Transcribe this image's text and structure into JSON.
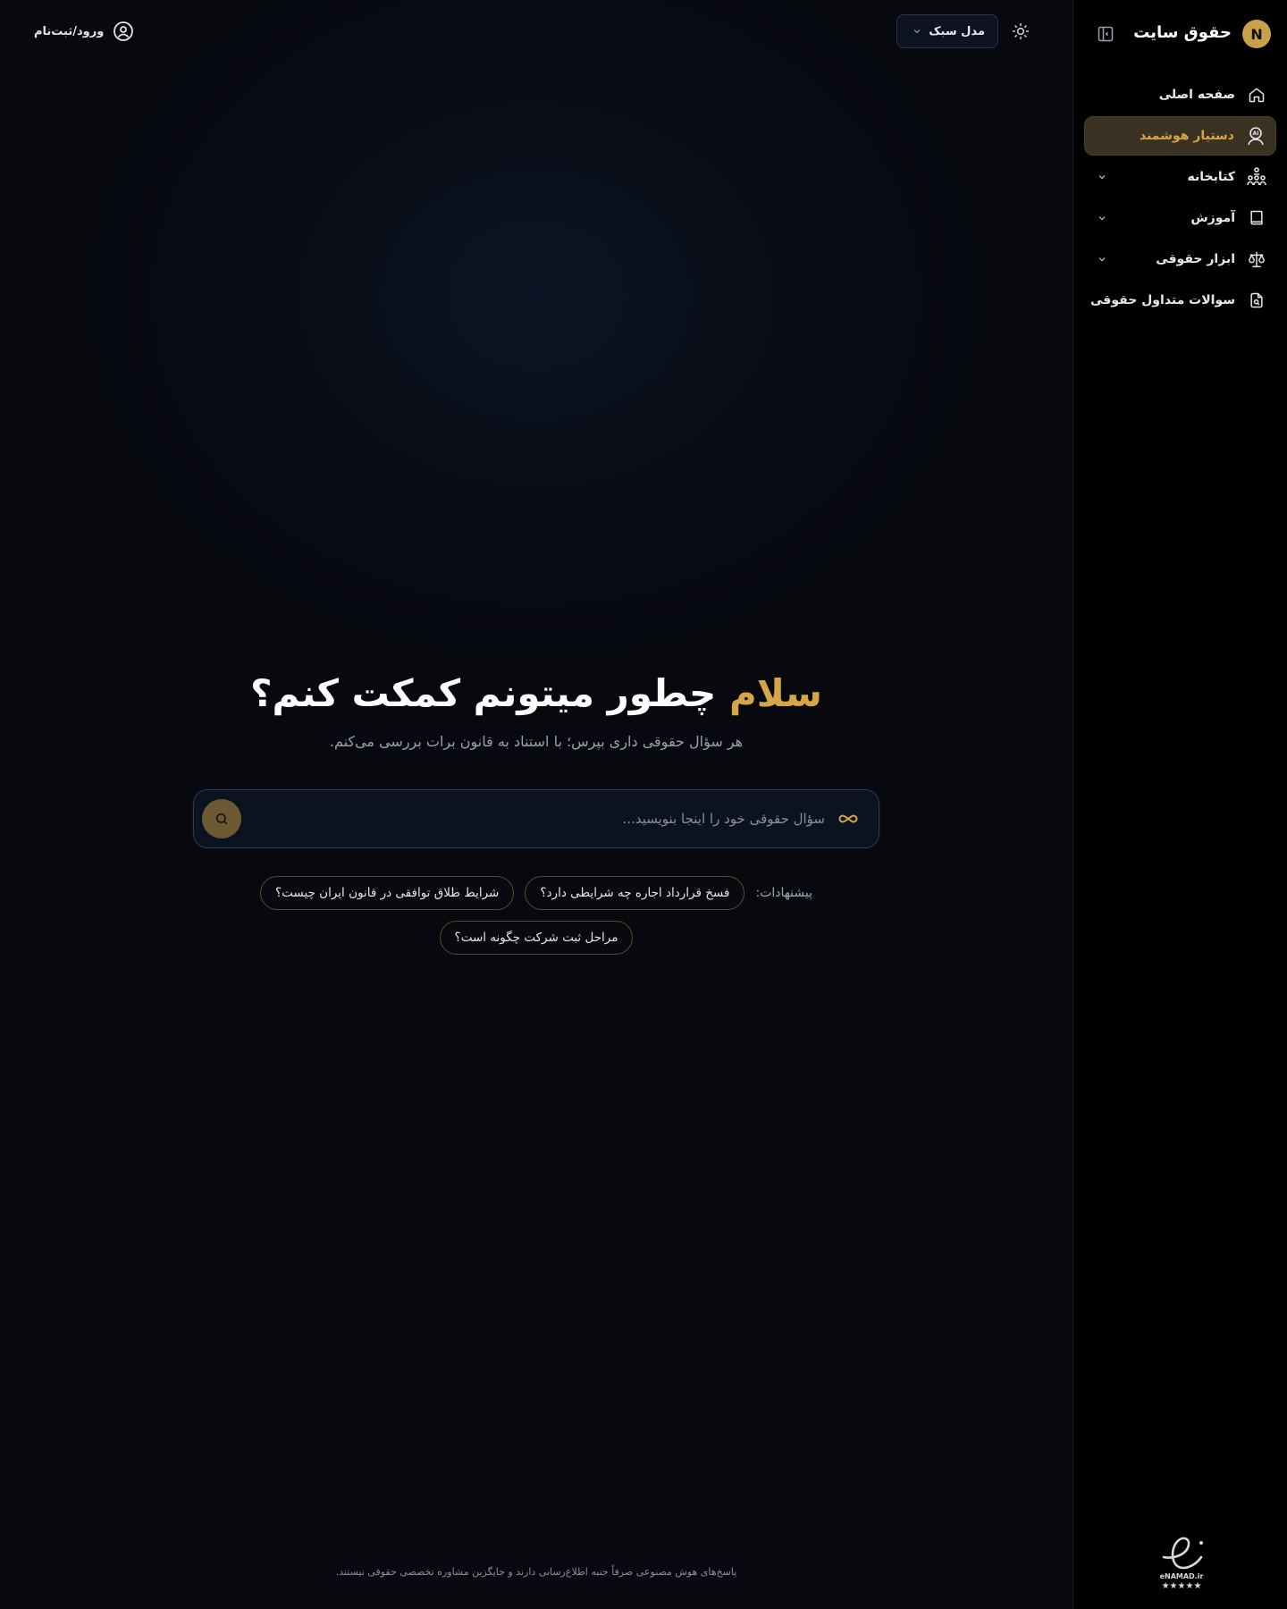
{
  "sidebar": {
    "brand": "حقوق سایت",
    "logo_letter": "N",
    "items": [
      {
        "label": "صفحه اصلی",
        "icon": "home-icon"
      },
      {
        "label": "دستیار هوشمند",
        "icon": "ai-robot-icon",
        "active": true
      },
      {
        "label": "کتابخانه",
        "icon": "library-icon",
        "expandable": true
      },
      {
        "label": "آموزش",
        "icon": "book-icon",
        "expandable": true
      },
      {
        "label": "ابزار حقوقی",
        "icon": "scale-icon",
        "expandable": true
      },
      {
        "label": "سوالات متداول حقوقی",
        "icon": "file-search-icon"
      }
    ],
    "enamad": {
      "line1": "eNAMAD.ir",
      "line2": "★★★★★"
    }
  },
  "header": {
    "login_label": "ورود/ثبت‌نام",
    "model_label": "مدل سبک"
  },
  "hero": {
    "title_accent": "سلام",
    "title_rest": " چطور میتونم کمکت کنم؟",
    "subtitle": "هر سؤال حقوقی داری بپرس؛ با استناد به قانون برات بررسی می‌کنم."
  },
  "search": {
    "placeholder": "سؤال حقوقی خود را اینجا بنویسید..."
  },
  "suggestions": {
    "label": "پیشنهادات:",
    "items": [
      "فسخ قرارداد اجاره چه شرایطی دارد؟",
      "شرایط طلاق توافقی در قانون ایران چیست؟",
      "مراحل ثبت شرکت چگونه است؟"
    ]
  },
  "footer": {
    "note": "پاسخ‌های هوش مصنوعی صرفاً جنبه اطلاع‌رسانی دارند و جایگزین مشاوره تخصصی حقوقی نیستند."
  },
  "colors": {
    "accent": "#d6a646",
    "background": "#07090e",
    "sidebar_bg": "#000000",
    "active_item_bg": "#3b3122"
  }
}
